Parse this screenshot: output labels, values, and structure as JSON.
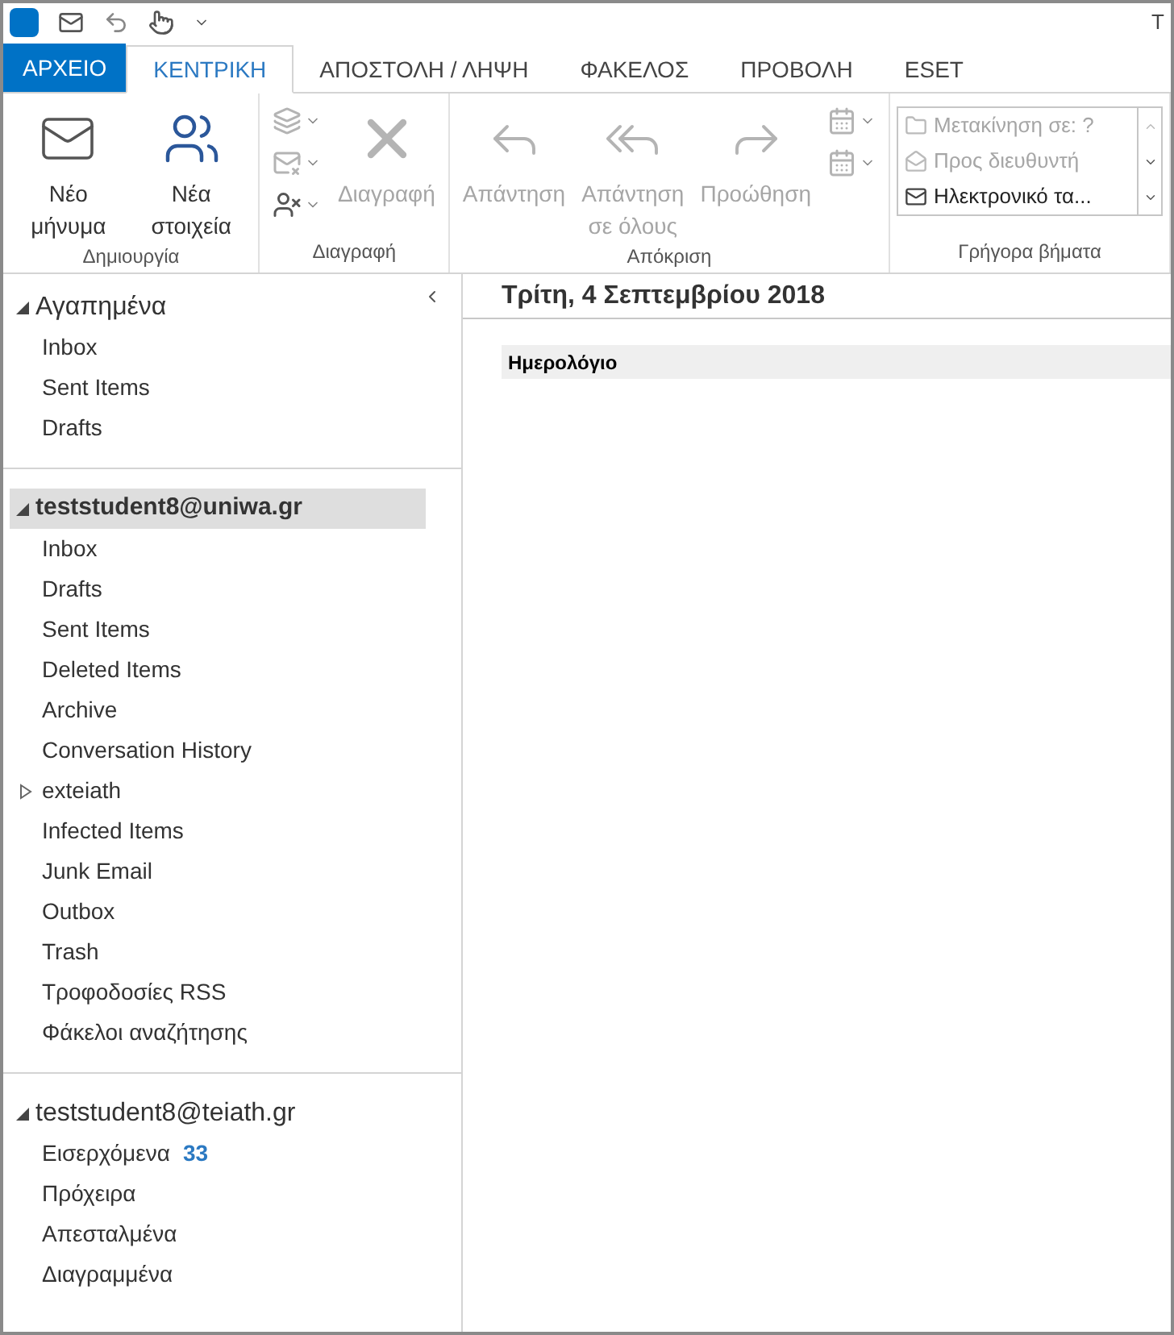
{
  "window": {
    "title": "Τ"
  },
  "tabs": [
    {
      "label": "ΑΡΧΕΙΟ",
      "kind": "file",
      "selected": false
    },
    {
      "label": "ΚΕΝΤΡΙΚΗ",
      "kind": "tab",
      "selected": true
    },
    {
      "label": "ΑΠΟΣΤΟΛΗ / ΛΗΨΗ",
      "kind": "tab",
      "selected": false
    },
    {
      "label": "ΦΑΚΕΛΟΣ",
      "kind": "tab",
      "selected": false
    },
    {
      "label": "ΠΡΟΒΟΛΗ",
      "kind": "tab",
      "selected": false
    },
    {
      "label": "ESET",
      "kind": "tab",
      "selected": false
    }
  ],
  "ribbon": {
    "groups": [
      {
        "label": "Δημιουργία",
        "buttons": [
          {
            "kind": "new-mail",
            "label": "Νέο μήνυμα",
            "disabled": false
          },
          {
            "kind": "new-items",
            "label": "Νέα στοιχεία",
            "disabled": false
          }
        ]
      },
      {
        "label": "Διαγραφή",
        "buttons": [
          {
            "kind": "small-stack",
            "disabled": true
          },
          {
            "kind": "delete",
            "label": "Διαγραφή",
            "disabled": true
          }
        ]
      },
      {
        "label": "Απόκριση",
        "buttons": [
          {
            "kind": "reply",
            "label": "Απάντηση",
            "disabled": true
          },
          {
            "kind": "reply-all",
            "label": "Απάντηση σε όλους",
            "disabled": true
          },
          {
            "kind": "forward",
            "label": "Προώθηση",
            "disabled": true
          },
          {
            "kind": "small-stack2",
            "disabled": true
          }
        ]
      },
      {
        "label": "Γρήγορα βήματα",
        "quick_steps": [
          {
            "label": "Μετακίνηση σε: ?",
            "disabled": true
          },
          {
            "label": "Προς διευθυντή",
            "disabled": true
          },
          {
            "label": "Ηλεκτρονικό τα...",
            "disabled": false
          }
        ]
      }
    ]
  },
  "folder_pane": {
    "sections": [
      {
        "title": "Αγαπημένα",
        "expanded": true,
        "selected": false,
        "folders": [
          {
            "name": "Inbox"
          },
          {
            "name": "Sent Items"
          },
          {
            "name": "Drafts"
          }
        ]
      },
      {
        "title": "teststudent8@uniwa.gr",
        "expanded": true,
        "selected": true,
        "folders": [
          {
            "name": "Inbox"
          },
          {
            "name": "Drafts"
          },
          {
            "name": "Sent Items"
          },
          {
            "name": "Deleted Items"
          },
          {
            "name": "Archive"
          },
          {
            "name": "Conversation History"
          },
          {
            "name": "exteiath",
            "expanded": false
          },
          {
            "name": "Infected Items"
          },
          {
            "name": "Junk Email"
          },
          {
            "name": "Outbox"
          },
          {
            "name": "Trash"
          },
          {
            "name": "Τροφοδοσίες RSS"
          },
          {
            "name": "Φάκελοι αναζήτησης"
          }
        ]
      },
      {
        "title": "teststudent8@teiath.gr",
        "expanded": true,
        "selected": false,
        "folders": [
          {
            "name": "Εισερχόμενα",
            "count": "33"
          },
          {
            "name": "Πρόχειρα"
          },
          {
            "name": "Απεσταλμένα"
          },
          {
            "name": "Διαγραμμένα"
          }
        ]
      }
    ]
  },
  "main": {
    "date": "Τρίτη, 4 Σεπτεμβρίου 2018",
    "section": "Ημερολόγιο"
  }
}
